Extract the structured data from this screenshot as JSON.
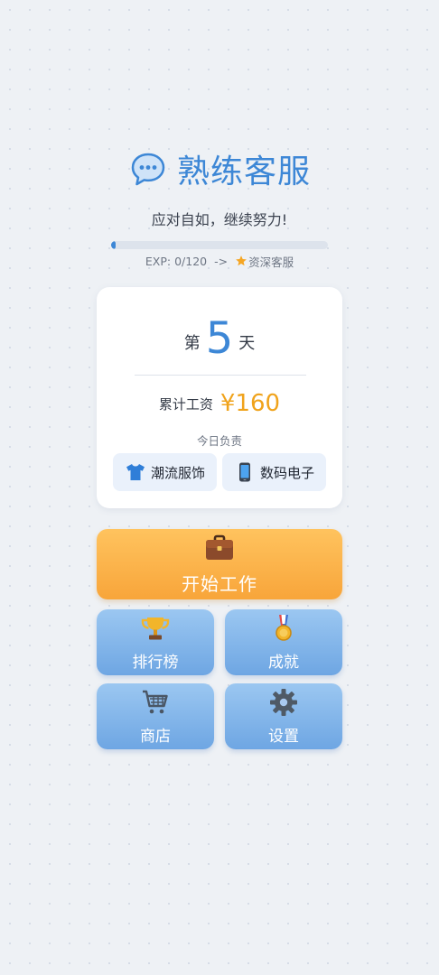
{
  "header": {
    "title": "熟练客服",
    "title_icon": "speech-bubble-icon",
    "subtitle": "应对自如，继续努力!",
    "exp_text": "EXP: 0/120",
    "exp_arrow": "->",
    "next_rank_icon": "star-icon",
    "next_rank": "资深客服",
    "exp_progress_fraction": 0.0
  },
  "card": {
    "day_prefix": "第",
    "day_number": "5",
    "day_suffix": "天",
    "salary_label": "累计工资",
    "salary_value": "¥160",
    "duty_label": "今日负责",
    "duties": [
      {
        "icon": "tshirt-icon",
        "label": "潮流服饰"
      },
      {
        "icon": "smartphone-icon",
        "label": "数码电子"
      }
    ]
  },
  "buttons": {
    "start": {
      "icon": "briefcase-icon",
      "label": "开始工作"
    },
    "leaderboard": {
      "icon": "trophy-icon",
      "label": "排行榜"
    },
    "achievements": {
      "icon": "medal-icon",
      "label": "成就"
    },
    "shop": {
      "icon": "shopping-cart-icon",
      "label": "商店"
    },
    "settings": {
      "icon": "gear-icon",
      "label": "设置"
    }
  },
  "colors": {
    "accent_blue": "#3d87d6",
    "salary_orange": "#f0a31b",
    "start_button": "#f8a53a",
    "secondary_button": "#7fb3ea",
    "background": "#eef1f5"
  }
}
